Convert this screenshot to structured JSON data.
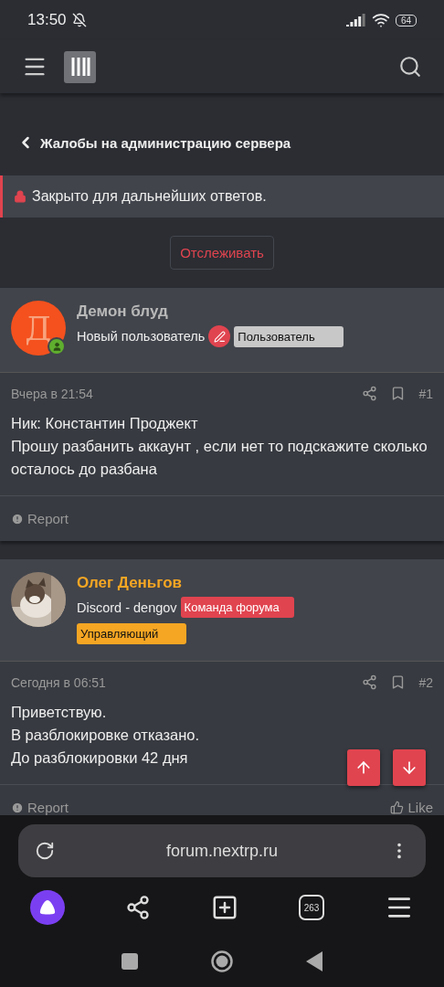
{
  "status_bar": {
    "time": "13:50",
    "battery": "64"
  },
  "breadcrumb": {
    "label": "Жалобы на администрацию сервера"
  },
  "notice": {
    "text": "Закрыто для дальнейших ответов."
  },
  "follow_button": {
    "label": "Отслеживать"
  },
  "posts": [
    {
      "author": {
        "name": "Демон блуд",
        "color": "#b9b9b9",
        "avatar": {
          "kind": "letter",
          "letter": "Д"
        },
        "online": true,
        "title": "Новый пользователь",
        "badges": [
          {
            "label": "Пользователь",
            "color": "#c8c8c8"
          }
        ],
        "role_icon": true
      },
      "date": "Вчера в 21:54",
      "number": "#1",
      "body": [
        "Ник: Константин Проджект",
        "Прошу разбанить аккаунт , если нет то подскажите сколько осталось до разбана"
      ],
      "footer": [
        "Report"
      ]
    },
    {
      "author": {
        "name": "Олег Деньгов",
        "color": "#f5a623",
        "online": false,
        "title": "Discord - dengov",
        "badges": [
          {
            "label": "Команда форума",
            "color": "#e0444f"
          },
          {
            "label": "Управляющий",
            "color": "#f5a623"
          }
        ],
        "role_icon": false
      },
      "date": "Сегодня в 06:51",
      "number": "#2",
      "body": [
        "Приветствую.",
        "В разблокировке отказано.",
        "До разблокировки 42 дня"
      ],
      "footer": [
        "Report",
        "Like"
      ]
    }
  ],
  "browser": {
    "url": "forum.nextrp.ru",
    "tabs_count": "263"
  }
}
